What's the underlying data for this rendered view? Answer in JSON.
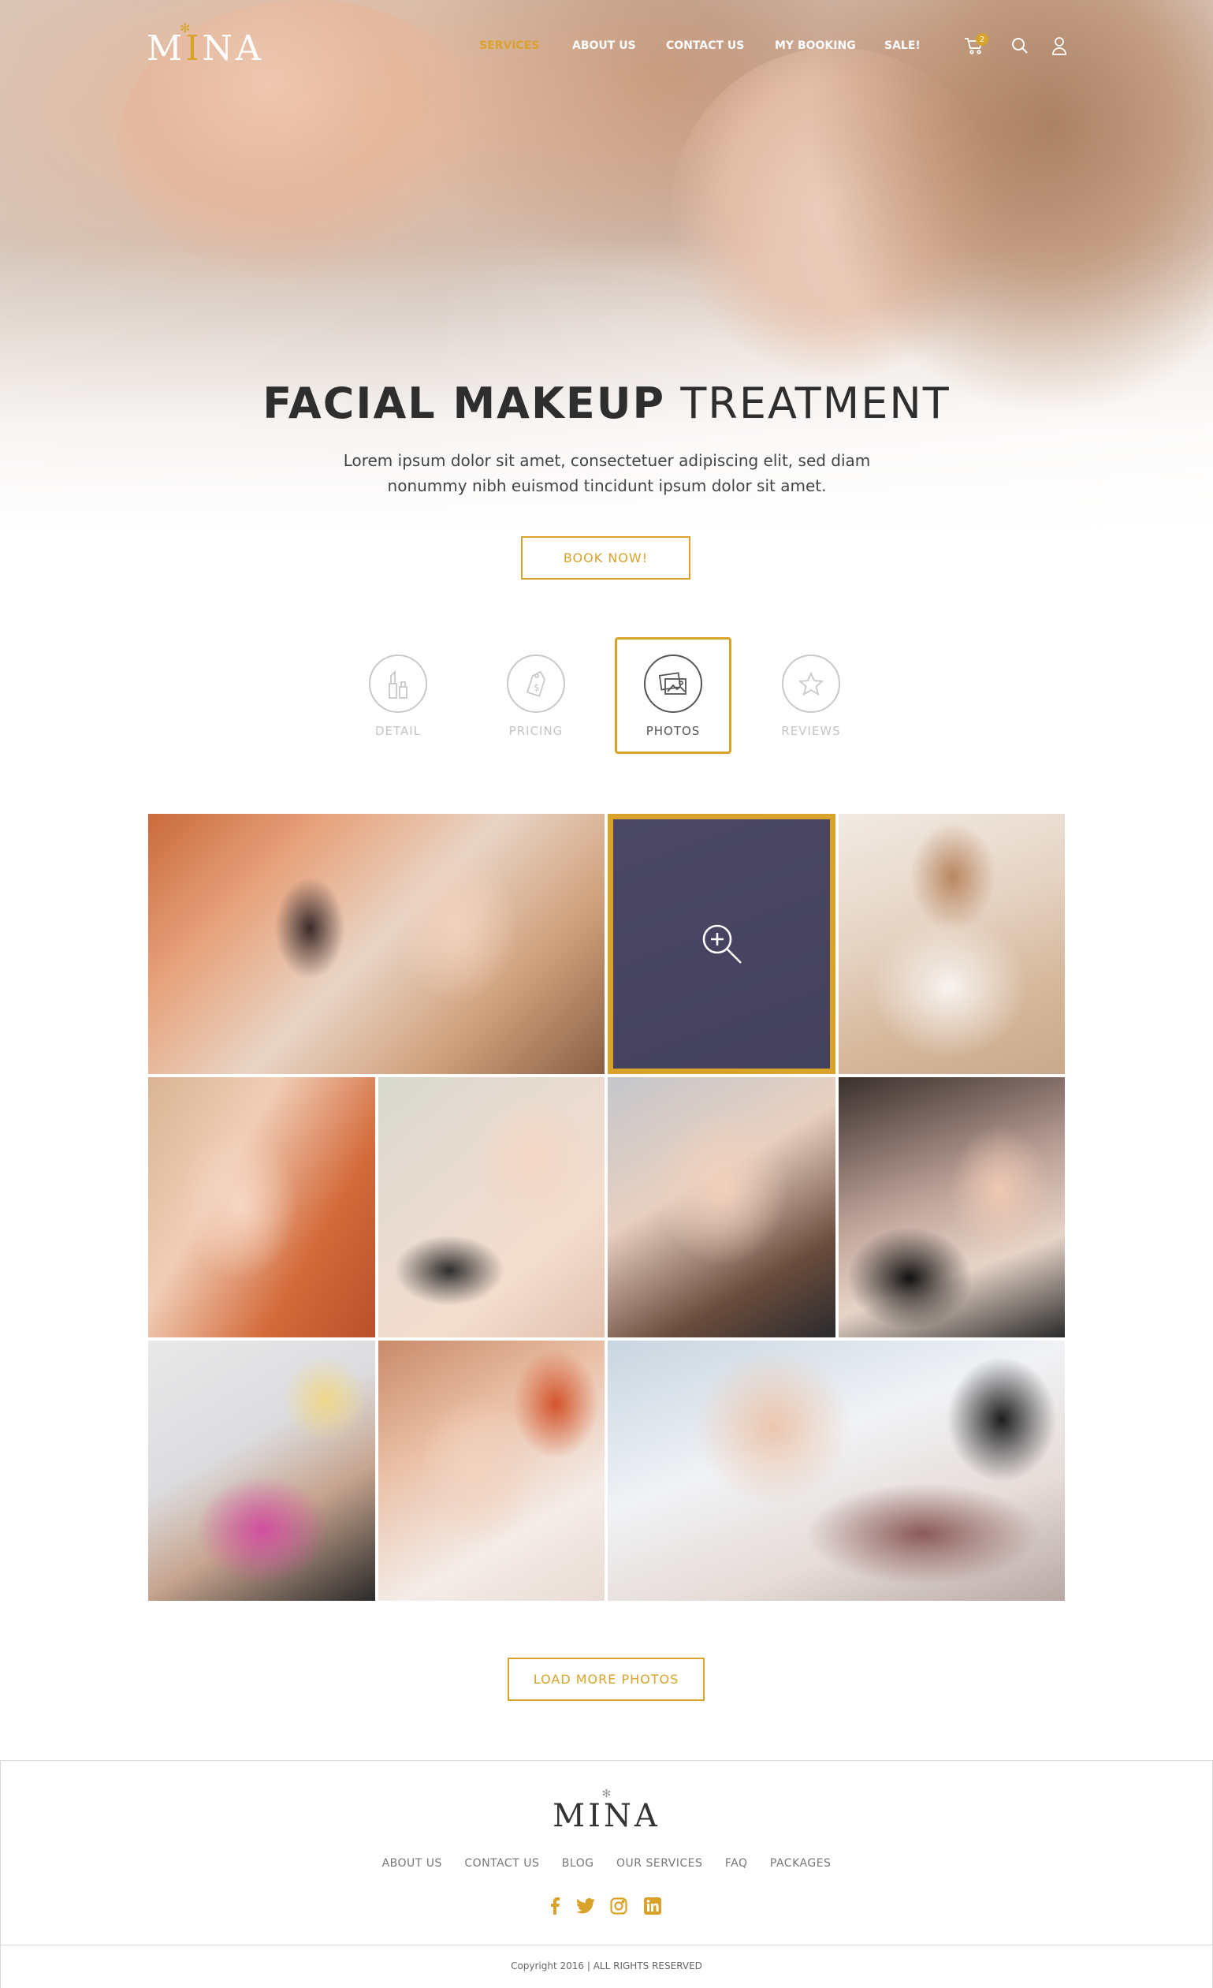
{
  "brand": {
    "logo_text_pre": "M",
    "logo_text_i": "I",
    "logo_text_post": "NA",
    "footer_logo": "MINA",
    "accent_color": "#d9a32b"
  },
  "nav": {
    "items": [
      {
        "label": "SERVICES",
        "active": true
      },
      {
        "label": "ABOUT US",
        "active": false
      },
      {
        "label": "CONTACT US",
        "active": false
      },
      {
        "label": "MY BOOKING",
        "active": false
      },
      {
        "label": "SALE!",
        "active": false
      }
    ],
    "cart_count": "2",
    "icons": [
      "cart-icon",
      "search-icon",
      "user-icon"
    ]
  },
  "hero": {
    "title_bold": "FACIAL MAKEUP",
    "title_light": "TREATMENT",
    "subtitle_line1": "Lorem ipsum dolor sit amet, consectetuer adipiscing elit, sed diam",
    "subtitle_line2": "nonummy nibh euismod tincidunt ipsum dolor sit amet.",
    "cta": "BOOK NOW!"
  },
  "tabs": [
    {
      "label": "DETAIL",
      "icon": "lipstick-icon",
      "active": false
    },
    {
      "label": "PRICING",
      "icon": "price-tag-icon",
      "active": false
    },
    {
      "label": "PHOTOS",
      "icon": "photos-icon",
      "active": true
    },
    {
      "label": "REVIEWS",
      "icon": "star-icon",
      "active": false
    }
  ],
  "gallery": {
    "load_more": "LOAD MORE PHOTOS",
    "hovered_photo_icon": "zoom-in-icon"
  },
  "footer": {
    "links": [
      "ABOUT US",
      "CONTACT US",
      "BLOG",
      "OUR SERVICES",
      "FAQ",
      "PACKAGES"
    ],
    "social": [
      "facebook-icon",
      "twitter-icon",
      "instagram-icon",
      "linkedin-icon"
    ],
    "copyright": "Copyright 2016 | ALL RIGHTS RESERVED"
  }
}
